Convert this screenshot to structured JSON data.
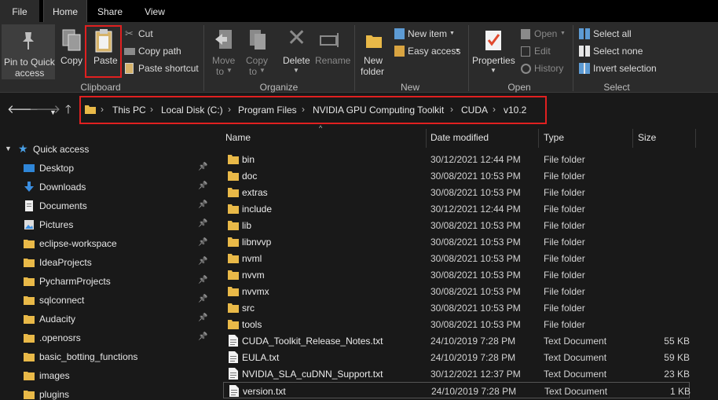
{
  "menu": {
    "file": "File",
    "home": "Home",
    "share": "Share",
    "view": "View"
  },
  "ribbon": {
    "clipboard": {
      "pin_line1": "Pin to Quick",
      "pin_line2": "access",
      "copy": "Copy",
      "paste": "Paste",
      "cut": "Cut",
      "copy_path": "Copy path",
      "paste_shortcut": "Paste shortcut",
      "group": "Clipboard"
    },
    "organize": {
      "move_line1": "Move",
      "move_line2": "to",
      "copy_line1": "Copy",
      "copy_line2": "to",
      "delete": "Delete",
      "rename": "Rename",
      "group": "Organize"
    },
    "new": {
      "new_folder_line1": "New",
      "new_folder_line2": "folder",
      "new_item": "New item",
      "easy_access": "Easy access",
      "group": "New"
    },
    "open": {
      "properties": "Properties",
      "open": "Open",
      "edit": "Edit",
      "history": "History",
      "group": "Open"
    },
    "select": {
      "select_all": "Select all",
      "select_none": "Select none",
      "invert_selection": "Invert selection",
      "group": "Select"
    }
  },
  "address": {
    "crumbs": [
      "This PC",
      "Local Disk (C:)",
      "Program Files",
      "NVIDIA GPU Computing Toolkit",
      "CUDA",
      "v10.2"
    ]
  },
  "nav": {
    "quick_access": "Quick access",
    "items": [
      {
        "label": "Desktop",
        "icon": "desktop-icon",
        "pinned": true
      },
      {
        "label": "Downloads",
        "icon": "downloads-icon",
        "pinned": true
      },
      {
        "label": "Documents",
        "icon": "documents-icon",
        "pinned": true
      },
      {
        "label": "Pictures",
        "icon": "pictures-icon",
        "pinned": true
      },
      {
        "label": "eclipse-workspace",
        "icon": "folder-icon",
        "pinned": true
      },
      {
        "label": "IdeaProjects",
        "icon": "folder-icon",
        "pinned": true
      },
      {
        "label": "PycharmProjects",
        "icon": "folder-icon",
        "pinned": true
      },
      {
        "label": "sqlconnect",
        "icon": "folder-icon",
        "pinned": true
      },
      {
        "label": "Audacity",
        "icon": "folder-icon",
        "pinned": true
      },
      {
        "label": ".openosrs",
        "icon": "folder-icon",
        "pinned": true
      },
      {
        "label": "basic_botting_functions",
        "icon": "folder-icon",
        "pinned": false
      },
      {
        "label": "images",
        "icon": "folder-icon",
        "pinned": false
      },
      {
        "label": "plugins",
        "icon": "folder-icon",
        "pinned": false
      }
    ]
  },
  "list": {
    "columns": {
      "name": "Name",
      "date": "Date modified",
      "type": "Type",
      "size": "Size"
    },
    "rows": [
      {
        "name": "bin",
        "date": "30/12/2021 12:44 PM",
        "type": "File folder",
        "size": "",
        "kind": "folder"
      },
      {
        "name": "doc",
        "date": "30/08/2021 10:53 PM",
        "type": "File folder",
        "size": "",
        "kind": "folder"
      },
      {
        "name": "extras",
        "date": "30/08/2021 10:53 PM",
        "type": "File folder",
        "size": "",
        "kind": "folder"
      },
      {
        "name": "include",
        "date": "30/12/2021 12:44 PM",
        "type": "File folder",
        "size": "",
        "kind": "folder"
      },
      {
        "name": "lib",
        "date": "30/08/2021 10:53 PM",
        "type": "File folder",
        "size": "",
        "kind": "folder"
      },
      {
        "name": "libnvvp",
        "date": "30/08/2021 10:53 PM",
        "type": "File folder",
        "size": "",
        "kind": "folder"
      },
      {
        "name": "nvml",
        "date": "30/08/2021 10:53 PM",
        "type": "File folder",
        "size": "",
        "kind": "folder"
      },
      {
        "name": "nvvm",
        "date": "30/08/2021 10:53 PM",
        "type": "File folder",
        "size": "",
        "kind": "folder"
      },
      {
        "name": "nvvmx",
        "date": "30/08/2021 10:53 PM",
        "type": "File folder",
        "size": "",
        "kind": "folder"
      },
      {
        "name": "src",
        "date": "30/08/2021 10:53 PM",
        "type": "File folder",
        "size": "",
        "kind": "folder"
      },
      {
        "name": "tools",
        "date": "30/08/2021 10:53 PM",
        "type": "File folder",
        "size": "",
        "kind": "folder"
      },
      {
        "name": "CUDA_Toolkit_Release_Notes.txt",
        "date": "24/10/2019 7:28 PM",
        "type": "Text Document",
        "size": "55 KB",
        "kind": "file"
      },
      {
        "name": "EULA.txt",
        "date": "24/10/2019 7:28 PM",
        "type": "Text Document",
        "size": "59 KB",
        "kind": "file"
      },
      {
        "name": "NVIDIA_SLA_cuDNN_Support.txt",
        "date": "30/12/2021 12:37 PM",
        "type": "Text Document",
        "size": "23 KB",
        "kind": "file"
      },
      {
        "name": "version.txt",
        "date": "24/10/2019 7:28 PM",
        "type": "Text Document",
        "size": "1 KB",
        "kind": "file"
      }
    ]
  }
}
